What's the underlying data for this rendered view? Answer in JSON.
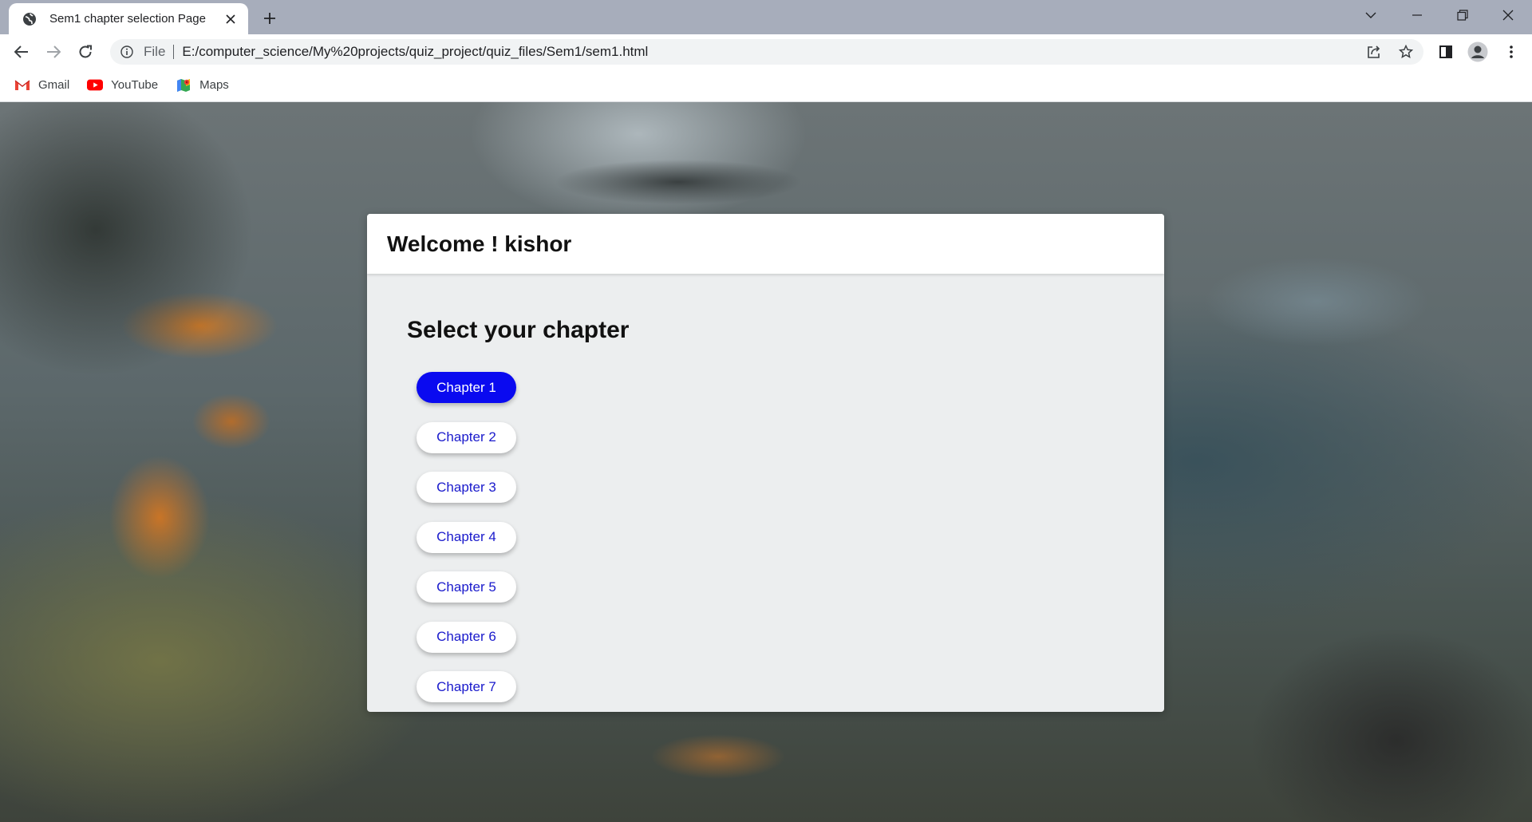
{
  "browser": {
    "tab": {
      "title": "Sem1 chapter selection Page"
    },
    "omnibox": {
      "scheme": "File",
      "url": "E:/computer_science/My%20projects/quiz_project/quiz_files/Sem1/sem1.html"
    },
    "bookmarks": [
      {
        "label": "Gmail",
        "icon": "gmail-icon"
      },
      {
        "label": "YouTube",
        "icon": "youtube-icon"
      },
      {
        "label": "Maps",
        "icon": "maps-icon"
      }
    ]
  },
  "page": {
    "welcome": "Welcome ! kishor",
    "heading": "Select your chapter",
    "chapters": [
      {
        "label": "Chapter 1",
        "selected": true
      },
      {
        "label": "Chapter 2",
        "selected": false
      },
      {
        "label": "Chapter 3",
        "selected": false
      },
      {
        "label": "Chapter 4",
        "selected": false
      },
      {
        "label": "Chapter 5",
        "selected": false
      },
      {
        "label": "Chapter 6",
        "selected": false
      },
      {
        "label": "Chapter 7",
        "selected": false
      }
    ],
    "colors": {
      "selected_button": "#0a0af0",
      "button_text": "#1a1acc"
    }
  }
}
